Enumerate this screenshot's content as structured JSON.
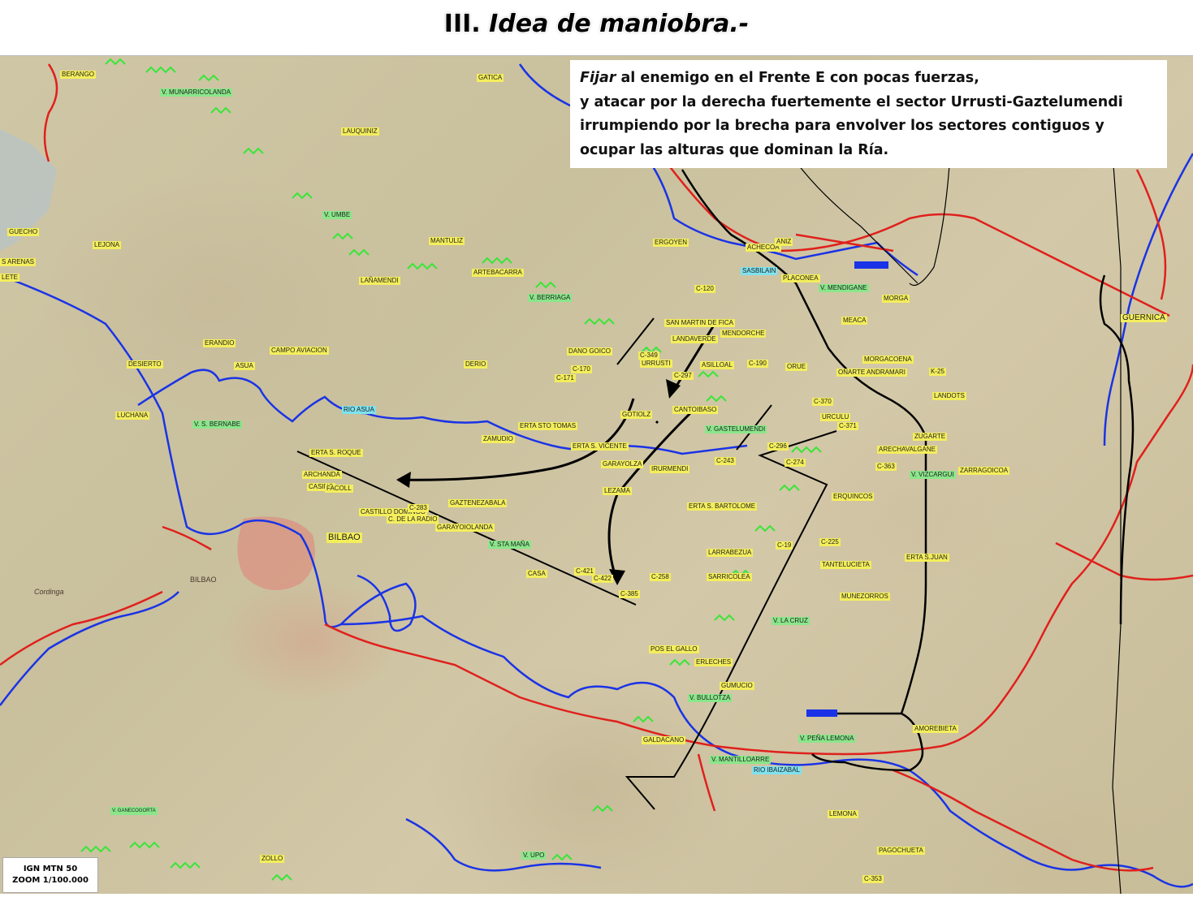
{
  "title": {
    "prefix": "III.",
    "main": "Idea de maniobra.-"
  },
  "note": {
    "lead": "Fijar",
    "line1_rest": " al enemigo en el Frente E con pocas fuerzas,",
    "line2": "y atacar por la derecha fuertemente el sector Urrusti-Gaztelumendi",
    "line3": "irrumpiendo por la brecha para envolver los sectores contiguos y",
    "line4": "ocupar las alturas que dominan la Ría."
  },
  "scale": {
    "line1": "IGN MTN 50",
    "line2": "ZOOM 1/100.000"
  },
  "colors": {
    "river": "#1a33e6",
    "road": "#e0201c",
    "front": "#000000",
    "defense": "#38e638",
    "town_label": "#f4ee5c",
    "vertex_label": "#8ae68a",
    "river_label": "#7fe2ee"
  },
  "labels": {
    "berango": "BERANGO",
    "gatica": "GATICA",
    "munarricolanda": "V. MUNARRICOLANDA",
    "lauquiniz": "LAUQUINIZ",
    "umbe": "V. UMBE",
    "guecho": "GUECHO",
    "lejona": "LEJONA",
    "arenas": "S ARENAS",
    "lete": "LETE",
    "mantuliz": "MANTULIZ",
    "ergoyen": "ERGOYEN",
    "aquecoa": "ACHECOA",
    "ganiz": "ANIZ",
    "sasbilain": "SASBILAIN",
    "artebacarra": "ARTEBACARRA",
    "lanamendi": "LAÑAMENDI",
    "placonea": "PLACONEA",
    "mendigane": "V. MENDIGANE",
    "morga": "MORGA",
    "c120": "C-120",
    "berriaga": "V. BERRIAGA",
    "sanmartin": "SAN MARTIN DE FICA",
    "meaca": "MEACA",
    "guernica": "GUERNICA",
    "landaverde": "LANDAVERDE",
    "mendorche": "MENDORCHE",
    "erandio": "ERANDIO",
    "campoaviacion": "CAMPO AVIACION",
    "danogoico": "DANO GOICO",
    "c349": "C-349",
    "urrusti": "URRUSTI",
    "asilloal": "ASILLOAL",
    "c190": "C-190",
    "morgacoena": "MORGACOENA",
    "desierto": "DESIERTO",
    "asua": "ASUA",
    "derio": "DERIO",
    "c170": "C-170",
    "c171": "C-171",
    "c297": "C-297",
    "orue": "ORUE",
    "onarte": "OÑARTE ANDRAMARI",
    "k25": "K-25",
    "landots": "LANDOTS",
    "rioasua": "RIO ASUA",
    "cantoibaso": "CANTOIBASO",
    "c370": "C-370",
    "urculu": "URCULU",
    "c371": "C-371",
    "luchana": "LUCHANA",
    "sbernabe": "V. S. BERNABE",
    "gotiolz": "GOTIOLZ",
    "stotomas": "ERTA STO TOMAS",
    "gaztelumendi": "V. GASTELUMENDI",
    "zugarte": "ZUGARTE",
    "zamudio": "ZAMUDIO",
    "svicente": "ERTA S. VICENTE",
    "c296": "C-296",
    "arechavalgane": "ARECHAVALGANE",
    "sroque": "ERTA S. ROQUE",
    "garayolza": "GARAYOLZA",
    "irurmendi": "IRURMENDI",
    "c243": "C-243",
    "c274": "C-274",
    "c363": "C-363",
    "vizcargui": "V. VIZCARGUI",
    "zarragoicoa": "ZARRAGOICOA",
    "archanda": "ARCHANDA",
    "casino": "CASINO",
    "facoll": "FACOLL",
    "lezama": "LEZAMA",
    "erquincos": "ERQUINCOS",
    "gaztenezabala": "GAZTENEZABALA",
    "sbartolome": "ERTA S. BARTOLOME",
    "castdomingo": "CASTILLO DOMINGO",
    "c283": "C-283",
    "radio": "C. DE LA RADIO",
    "garayoiolanda": "GARAYOIOLANDA",
    "bilbao": "BILBAO",
    "stamana": "V. STA MAÑA",
    "c19": "C-19",
    "c225": "C-225",
    "larrabezua": "LARRABEZUA",
    "tantelucieta": "TANTELUCIETA",
    "sjuan": "ERTA S.JUAN",
    "casa": "CASA",
    "c421": "C-421",
    "c422": "C-422",
    "c258": "C-258",
    "sarricolea": "SARRICOLEA",
    "c385": "C-385",
    "munezorros": "MUNEZORROS",
    "lacruz": "V. LA CRUZ",
    "gallo": "POS EL GALLO",
    "erleches": "ERLECHES",
    "gumucio": "GUMUCIO",
    "bullotza": "V. BULLOTZA",
    "galdacano": "GALDACANO",
    "penalemona": "V. PEÑA LEMONA",
    "amorebieta": "AMOREBIETA",
    "mantilloarre": "V. MANTILLOARRE",
    "rioibaizabal": "RIO IBAIZABAL",
    "ganecoerta": "V. GANECOGORTA",
    "lemona": "LEMONA",
    "zollo": "ZOLLO",
    "upo": "V. UPO",
    "pagochueta": "PAGOCHUETA",
    "c353": "C-353",
    "bilbaomap": "BILBAO",
    "cordinga": "Cordinga"
  }
}
